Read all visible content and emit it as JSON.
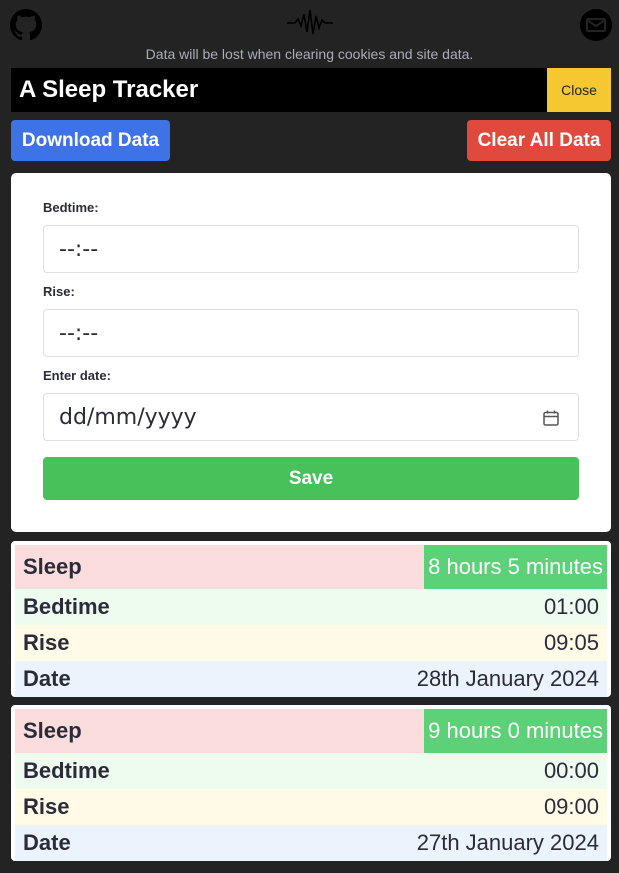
{
  "header": {
    "notice": "Data will be lost when clearing cookies and site data.",
    "title": "A Sleep Tracker",
    "close_label": "Close",
    "icons": [
      "github-icon",
      "waveform-logo-icon",
      "mail-icon"
    ]
  },
  "actions": {
    "download_label": "Download Data",
    "clear_label": "Clear All Data"
  },
  "form": {
    "bedtime_label": "Bedtime:",
    "bedtime_value": "--:--",
    "rise_label": "Rise:",
    "rise_value": "--:--",
    "date_label": "Enter date:",
    "date_value": "dd/mm/yyyy",
    "save_label": "Save"
  },
  "entries": [
    {
      "sleep_label": "Sleep",
      "sleep_value": "8 hours 5 minutes",
      "bedtime_label": "Bedtime",
      "bedtime_value": "01:00",
      "rise_label": "Rise",
      "rise_value": "09:05",
      "date_label": "Date",
      "date_value": "28th January 2024"
    },
    {
      "sleep_label": "Sleep",
      "sleep_value": "9 hours 0 minutes",
      "bedtime_label": "Bedtime",
      "bedtime_value": "00:00",
      "rise_label": "Rise",
      "rise_value": "09:00",
      "date_label": "Date",
      "date_value": "27th January 2024"
    }
  ],
  "colors": {
    "background": "#232323",
    "download": "#3e73e8",
    "clear": "#e04a3d",
    "close": "#f5c731",
    "save": "#48c15a",
    "sleep_value": "#5cd177"
  }
}
